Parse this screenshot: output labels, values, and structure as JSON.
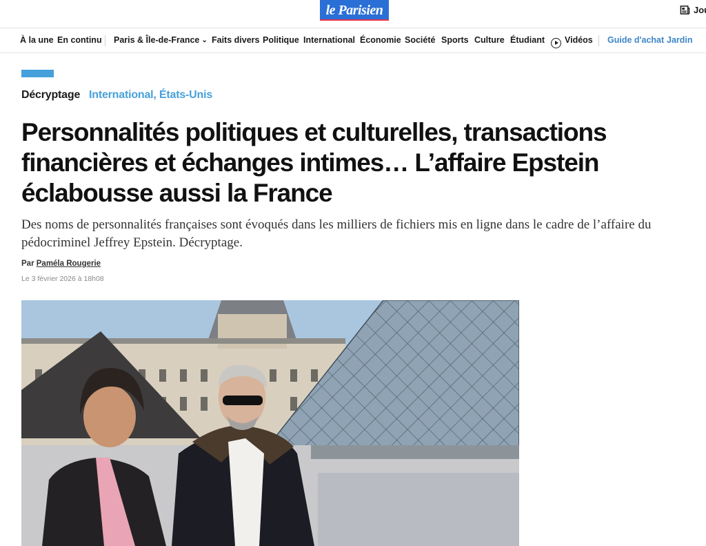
{
  "header": {
    "logo_text": "le Parisien",
    "journal_label": "Jou"
  },
  "nav": {
    "items": [
      {
        "label": "À la une"
      },
      {
        "label": "En continu"
      },
      {
        "label": "Paris & Île-de-France"
      },
      {
        "label": "Faits divers"
      },
      {
        "label": "Politique"
      },
      {
        "label": "International"
      },
      {
        "label": "Économie"
      },
      {
        "label": "Société"
      },
      {
        "label": "Sports"
      },
      {
        "label": "Culture"
      },
      {
        "label": "Étudiant"
      },
      {
        "label": "Vidéos"
      },
      {
        "label": "Guide d'achat"
      },
      {
        "label": "Jardin"
      }
    ]
  },
  "article": {
    "kicker": "Décryptage",
    "category": "International, États-Unis",
    "title": "Personnalités politiques et culturelles, transactions financières et échanges intimes… L’affaire Epstein éclabousse aussi la France",
    "lead": "Des noms de personnalités françaises sont évoqués dans les milliers de fichiers mis en ligne dans le cadre de l’affaire du pédocriminel Jeffrey Epstein. Décryptage.",
    "byline_prefix": "Par",
    "author": "Paméla Rougerie",
    "date": "Le 3 février 2026 à 18h08"
  },
  "colors": {
    "accent_blue": "#46a0db",
    "logo_blue": "#2a6fd6",
    "logo_red": "#e8334a",
    "nav_blue": "#3d86c6"
  },
  "icons": {
    "journal": "newspaper-icon",
    "dropdown": "chevron-down-icon",
    "video": "play-circle-icon"
  }
}
